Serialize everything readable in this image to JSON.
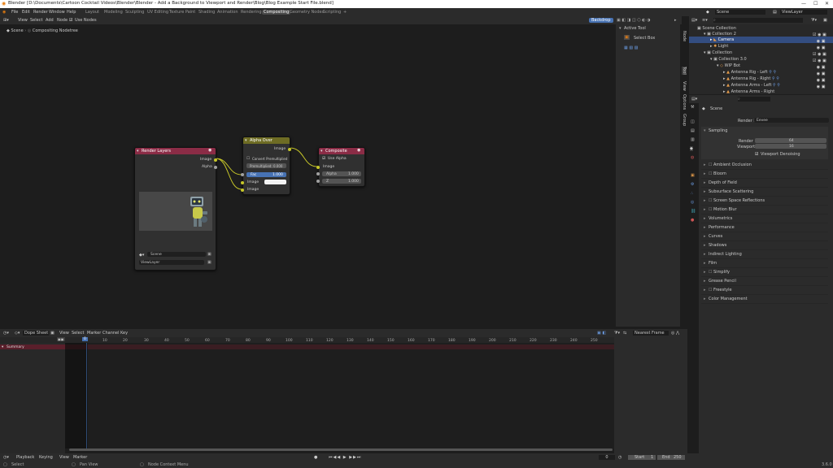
{
  "window": {
    "title": "Blender [D:\\Documents\\Cartoon Cocktail Videos\\Blender\\Blender - Add a Background to Viewport and Render\\Blog\\Blog Example Start File.blend]",
    "min": "—",
    "max": "☐",
    "close": "✕"
  },
  "menu": [
    "File",
    "Edit",
    "Render",
    "Window",
    "Help"
  ],
  "workspaces": [
    "Layout",
    "Modeling",
    "Sculpting",
    "UV Editing",
    "Texture Paint",
    "Shading",
    "Animation",
    "Rendering",
    "Compositing",
    "Geometry Nodes",
    "Scripting",
    "+"
  ],
  "active_workspace": "Compositing",
  "scene_field": "Scene",
  "viewlayer_field": "ViewLayer",
  "node_header": {
    "items": [
      "View",
      "Select",
      "Add",
      "Node"
    ],
    "use_nodes": "Use Nodes",
    "backdrop": "Backdrop"
  },
  "breadcrumb": {
    "scene": "Scene",
    "tree": "Compositing Nodetree"
  },
  "nodes": {
    "render_layers": {
      "title": "Render Layers",
      "out_image": "Image",
      "out_alpha": "Alpha",
      "scene": "Scene",
      "layer": "ViewLayer"
    },
    "alpha_over": {
      "title": "Alpha Over",
      "out_image": "Image",
      "convert": "Convert Premultiplied",
      "premul": "Premultiplied: 0.000",
      "fac_label": "Fac",
      "fac_value": "1.000",
      "in1": "Image",
      "in2": "Image"
    },
    "composite": {
      "title": "Composite",
      "use_alpha": "Use Alpha",
      "in_image": "Image",
      "alpha_label": "Alpha",
      "alpha_value": "1.000",
      "z_label": "Z",
      "z_value": "1.000"
    }
  },
  "sidepanel": {
    "header": "Active Tool",
    "tool": "Select Box",
    "tabs": [
      "Node",
      "Tool",
      "View",
      "Options",
      "Group"
    ]
  },
  "outliner": {
    "search": "",
    "rows": [
      {
        "label": "Scene Collection",
        "indent": 0
      },
      {
        "label": "Collection 2",
        "indent": 1
      },
      {
        "label": "Camera",
        "indent": 2,
        "selected": true
      },
      {
        "label": "Light",
        "indent": 2
      },
      {
        "label": "Collection",
        "indent": 1
      },
      {
        "label": "Collection 3.0",
        "indent": 2
      },
      {
        "label": "WIP Bot",
        "indent": 3
      },
      {
        "label": "Antenna Rig - Left",
        "indent": 4
      },
      {
        "label": "Antenna Rig - Right",
        "indent": 4
      },
      {
        "label": "Antenna Arms - Left",
        "indent": 4
      },
      {
        "label": "Antenna Arms - Right",
        "indent": 4
      }
    ]
  },
  "properties": {
    "scene": "Scene",
    "render_engine_label": "Render Engine",
    "render_engine": "Eevee",
    "sampling": "Sampling",
    "render_label": "Render",
    "render_value": "64",
    "viewport_label": "Viewport",
    "viewport_value": "16",
    "viewport_denoising": "Viewport Denoising",
    "panels": [
      "Ambient Occlusion",
      "Bloom",
      "Depth of Field",
      "Subsurface Scattering",
      "Screen Space Reflections",
      "Motion Blur",
      "Volumetrics",
      "Performance",
      "Curves",
      "Shadows",
      "Indirect Lighting",
      "Film",
      "Simplify",
      "Grease Pencil",
      "Freestyle",
      "Color Management"
    ]
  },
  "timeline": {
    "editor": "Dope Sheet",
    "menu": [
      "View",
      "Select",
      "Marker",
      "Channel",
      "Key"
    ],
    "summary": "Summary",
    "nearest": "Nearest Frame",
    "current_frame": "0",
    "ticks": [
      "0",
      "10",
      "20",
      "30",
      "40",
      "50",
      "60",
      "70",
      "80",
      "90",
      "100",
      "110",
      "120",
      "130",
      "140",
      "150",
      "160",
      "170",
      "180",
      "190",
      "200",
      "210",
      "220",
      "230",
      "240",
      "250"
    ]
  },
  "playback": {
    "menu": [
      "Playback",
      "Keying",
      "View",
      "Marker"
    ],
    "start_label": "Start",
    "start": "1",
    "end_label": "End",
    "end": "250",
    "frame": "0"
  },
  "status": {
    "select": "Select",
    "pan": "Pan View",
    "menu": "Node Context Menu",
    "version": "3.6.0"
  }
}
